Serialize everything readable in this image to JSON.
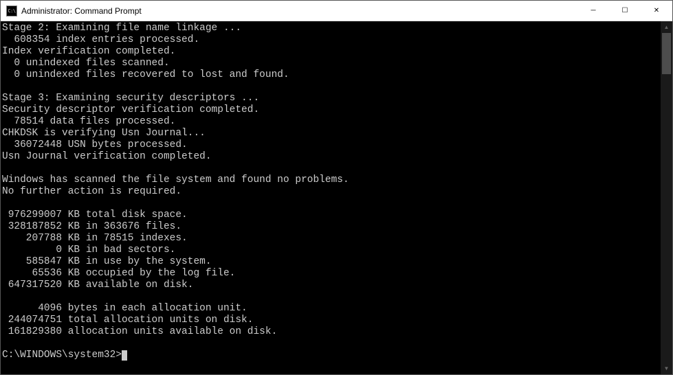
{
  "window": {
    "title": "Administrator: Command Prompt",
    "icon_label": "C:\\"
  },
  "controls": {
    "minimize": "─",
    "maximize": "☐",
    "close": "✕"
  },
  "terminal": {
    "lines": [
      "Stage 2: Examining file name linkage ...",
      "  608354 index entries processed.",
      "Index verification completed.",
      "  0 unindexed files scanned.",
      "  0 unindexed files recovered to lost and found.",
      "",
      "Stage 3: Examining security descriptors ...",
      "Security descriptor verification completed.",
      "  78514 data files processed.",
      "CHKDSK is verifying Usn Journal...",
      "  36072448 USN bytes processed.",
      "Usn Journal verification completed.",
      "",
      "Windows has scanned the file system and found no problems.",
      "No further action is required.",
      "",
      " 976299007 KB total disk space.",
      " 328187852 KB in 363676 files.",
      "    207788 KB in 78515 indexes.",
      "         0 KB in bad sectors.",
      "    585847 KB in use by the system.",
      "     65536 KB occupied by the log file.",
      " 647317520 KB available on disk.",
      "",
      "      4096 bytes in each allocation unit.",
      " 244074751 total allocation units on disk.",
      " 161829380 allocation units available on disk.",
      ""
    ],
    "prompt": "C:\\WINDOWS\\system32>"
  }
}
